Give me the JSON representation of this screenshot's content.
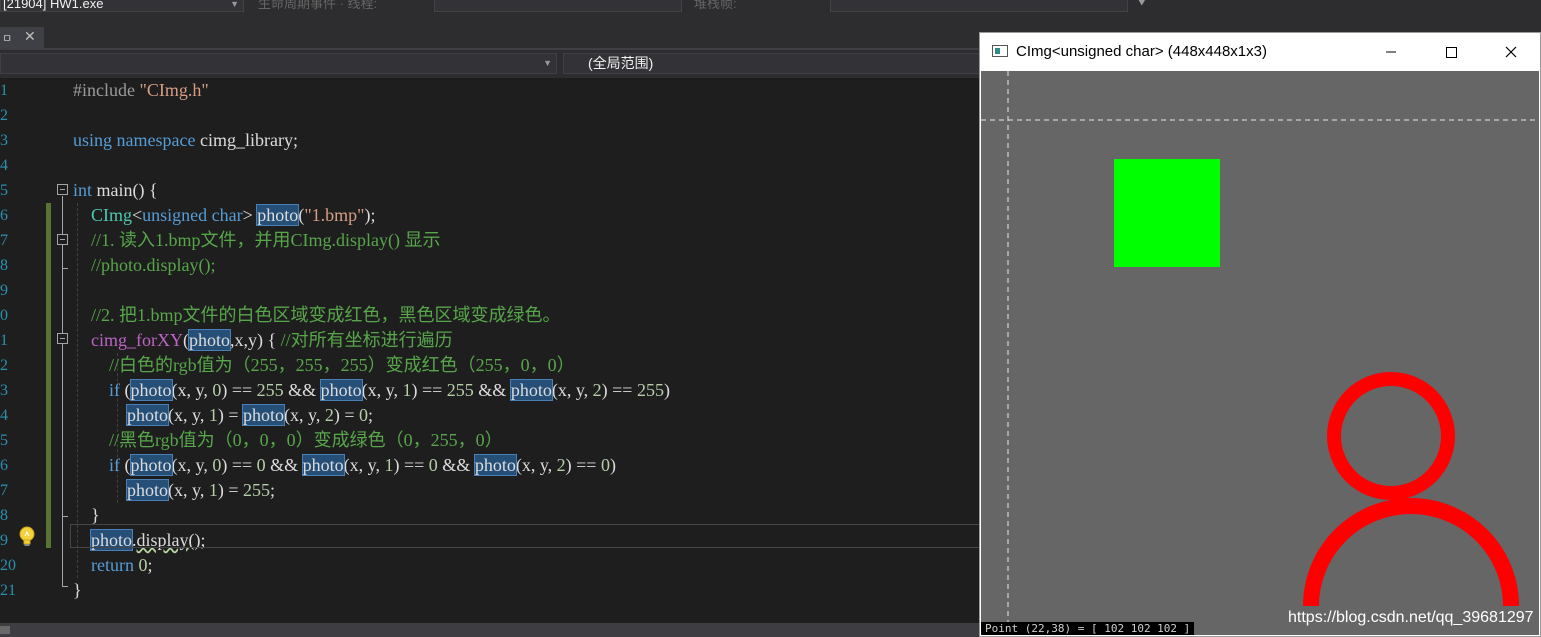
{
  "toolbar": {
    "process": "[21904] HW1.exe",
    "lifecycle_label": "生命周期事件 ·  线程:",
    "stackframe_label": "堆栈帧:"
  },
  "tab": {
    "pin": "ㅁ",
    "close": "✕"
  },
  "nav": {
    "scope": "(全局范围)"
  },
  "editor": {
    "line_numbers": [
      "1",
      "2",
      "3",
      "4",
      "5",
      "6",
      "7",
      "8",
      "9",
      "0",
      "1",
      "2",
      "3",
      "4",
      "5",
      "6",
      "7",
      "8",
      "9",
      "20",
      "21"
    ],
    "lines": [
      "#include \"CImg.h\"",
      "",
      "using namespace cimg_library;",
      "",
      "int main() {",
      "    CImg<unsigned char> photo(\"1.bmp\");",
      "    //1. 读入1.bmp文件，并用CImg.display() 显示",
      "    //photo.display();",
      "",
      "    //2. 把1.bmp文件的白色区域变成红色，黑色区域变成绿色。",
      "    cimg_forXY(photo,x,y) { //对所有坐标进行遍历",
      "        //白色的rgb值为（255，255，255）变成红色（255，0，0）",
      "        if (photo(x, y, 0) == 255 && photo(x, y, 1) == 255 && photo(x, y, 2) == 255)",
      "            photo(x, y, 1) = photo(x, y, 2) = 0;",
      "        //黑色rgb值为（0，0，0）变成绿色（0，255，0）",
      "        if (photo(x, y, 0) == 0 && photo(x, y, 1) == 0 && photo(x, y, 2) == 0)",
      "            photo(x, y, 1) = 255;",
      "    }",
      "    photo.display();",
      "    return 0;",
      "}"
    ]
  },
  "cimg_window": {
    "title": "CImg<unsigned char> (448x448x1x3)",
    "status": "Point (22,38) = [ 102 102 102 ]"
  },
  "watermark": "https://blog.csdn.net/qq_39681297",
  "colors": {
    "editor_bg": "#1e1e1e",
    "line_number": "#2b91af",
    "keyword": "#569cd6",
    "type": "#4ec9b0",
    "string": "#d69d85",
    "comment": "#57a64a",
    "macro": "#bd63c5",
    "number": "#b5cea8",
    "highlight": "#264f78",
    "canvas_bg": "#666666",
    "green_square": "#00ff00",
    "red_figure": "#ff0000"
  },
  "icons": {
    "lightbulb": "lightbulb-icon",
    "fold": "collapse-icon",
    "window_minimize": "minimize-icon",
    "window_maximize": "maximize-icon",
    "window_close": "close-icon"
  }
}
